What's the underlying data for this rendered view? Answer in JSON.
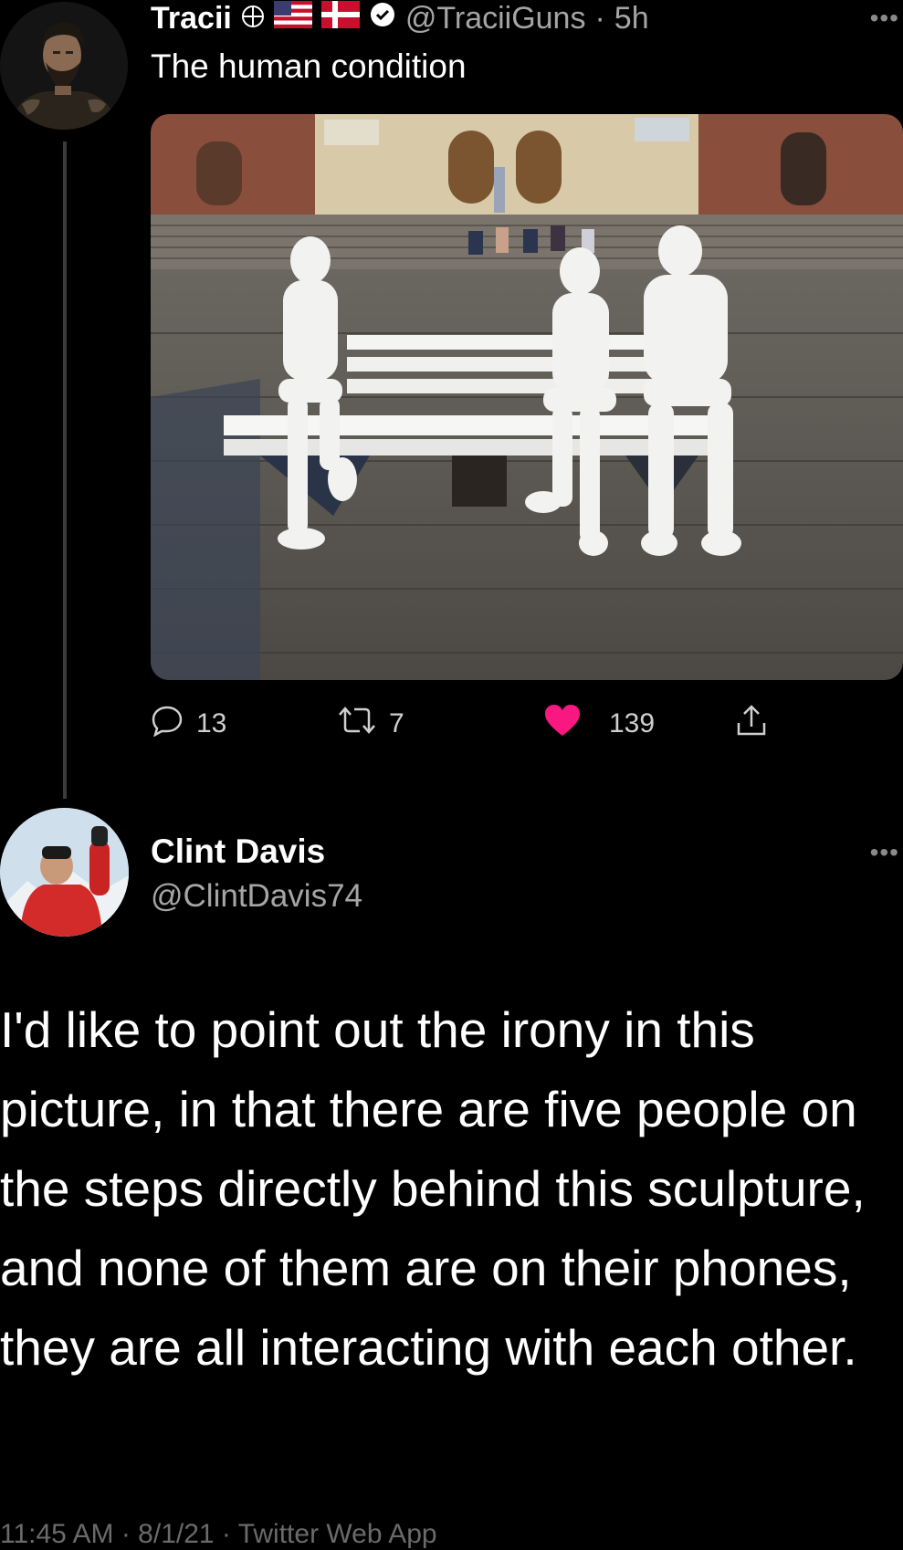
{
  "tweet1": {
    "display_name": "Tracii",
    "handle": "@TraciiGuns",
    "time": "5h",
    "text": "The human condition",
    "replies": "13",
    "retweets": "7",
    "likes": "139",
    "icons": {
      "globe": "globe-plus-icon",
      "flag1": "us-flag-icon",
      "flag2": "denmark-flag-icon",
      "verified": "verified-icon",
      "more": "more-icon",
      "reply": "reply-icon",
      "retweet": "retweet-icon",
      "like": "heart-icon",
      "share": "share-icon"
    }
  },
  "tweet2": {
    "display_name": "Clint Davis",
    "handle": "@ClintDavis74",
    "text": "I'd like to point out the irony in this picture, in that there are five people on the steps directly behind this sculpture, and none of them are on their phones, they are all interacting with each other.",
    "footer": "11:45 AM · 8/1/21 · Twitter Web App",
    "icons": {
      "more": "more-icon"
    }
  },
  "colors": {
    "background": "#000000",
    "text": "#ffffff",
    "muted": "#a5a5a5",
    "like": "#f91880"
  }
}
